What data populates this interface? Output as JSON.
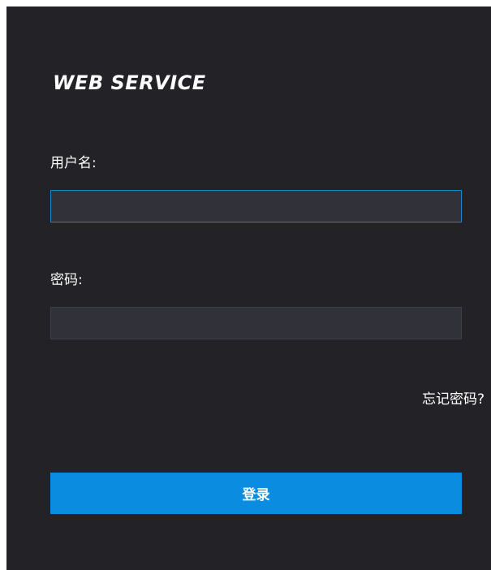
{
  "login": {
    "title": "WEB SERVICE",
    "username_label": "用户名:",
    "username_value": "",
    "password_label": "密码:",
    "password_value": "",
    "forgot_password": "忘记密码?",
    "login_button": "登录"
  },
  "colors": {
    "panel_background": "#232327",
    "input_background": "#31313a",
    "input_focus_border": "#1a86d0",
    "button_background": "#0a8ce0",
    "text": "#ffffff"
  }
}
